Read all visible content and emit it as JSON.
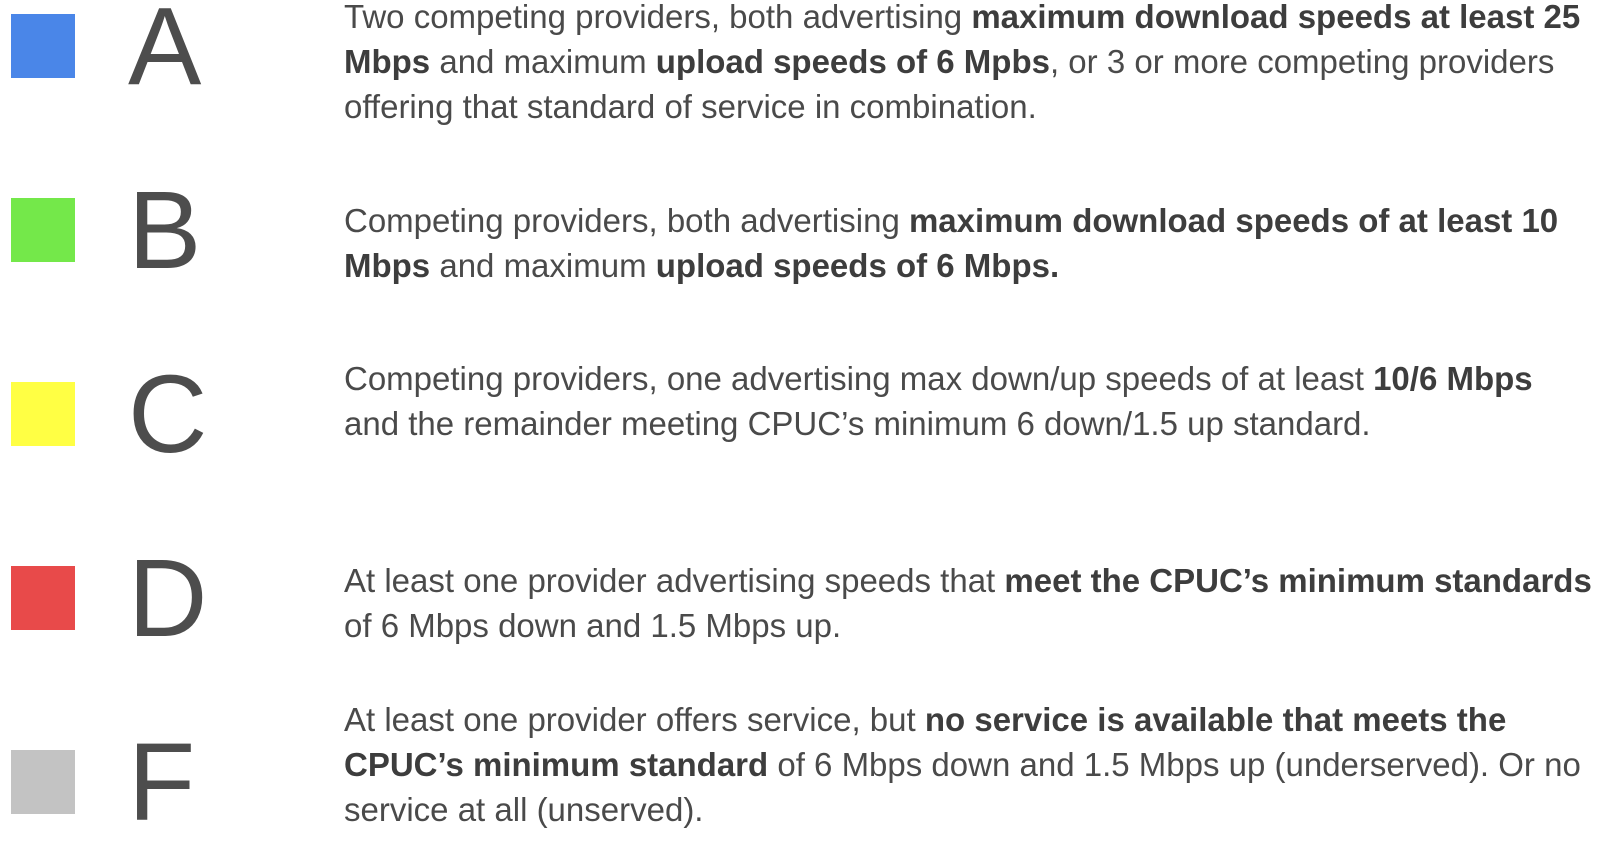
{
  "legend": [
    {
      "grade": "A",
      "color": "#4a86e8",
      "description": [
        {
          "text": "Two competing providers, both advertising ",
          "bold": false
        },
        {
          "text": "maximum download speeds at least 25 Mbps",
          "bold": true
        },
        {
          "text": " and maximum ",
          "bold": false
        },
        {
          "text": "upload speeds of 6 Mpbs",
          "bold": true
        },
        {
          "text": ", or 3 or more competing providers offering that standard of service in combination.",
          "bold": false
        }
      ]
    },
    {
      "grade": "B",
      "color": "#74e84a",
      "description": [
        {
          "text": "Competing providers, both advertising ",
          "bold": false
        },
        {
          "text": "maximum download speeds of at least 10 Mbps",
          "bold": true
        },
        {
          "text": " and maximum ",
          "bold": false
        },
        {
          "text": "upload speeds of 6 Mbps.",
          "bold": true
        }
      ]
    },
    {
      "grade": "C",
      "color": "#ffff44",
      "description": [
        {
          "text": "Competing providers, one advertising max down/up speeds of at least ",
          "bold": false
        },
        {
          "text": "10/6 Mbps",
          "bold": true
        },
        {
          "text": " and the remainder meeting CPUC’s minimum 6 down/1.5 up standard.",
          "bold": false
        }
      ]
    },
    {
      "grade": "D",
      "color": "#e84a4a",
      "description": [
        {
          "text": "At least one provider advertising speeds that ",
          "bold": false
        },
        {
          "text": "meet the CPUC’s minimum standards",
          "bold": true
        },
        {
          "text": " of 6 Mbps down and 1.5 Mbps up.",
          "bold": false
        }
      ]
    },
    {
      "grade": "F",
      "color": "#c3c3c3",
      "description": [
        {
          "text": "At least one provider offers service, but ",
          "bold": false
        },
        {
          "text": "no service is available that meets the CPUC’s minimum standard",
          "bold": true
        },
        {
          "text": " of 6 Mbps down and 1.5 Mbps up (underserved). Or no service at all (unserved).",
          "bold": false
        }
      ]
    }
  ]
}
